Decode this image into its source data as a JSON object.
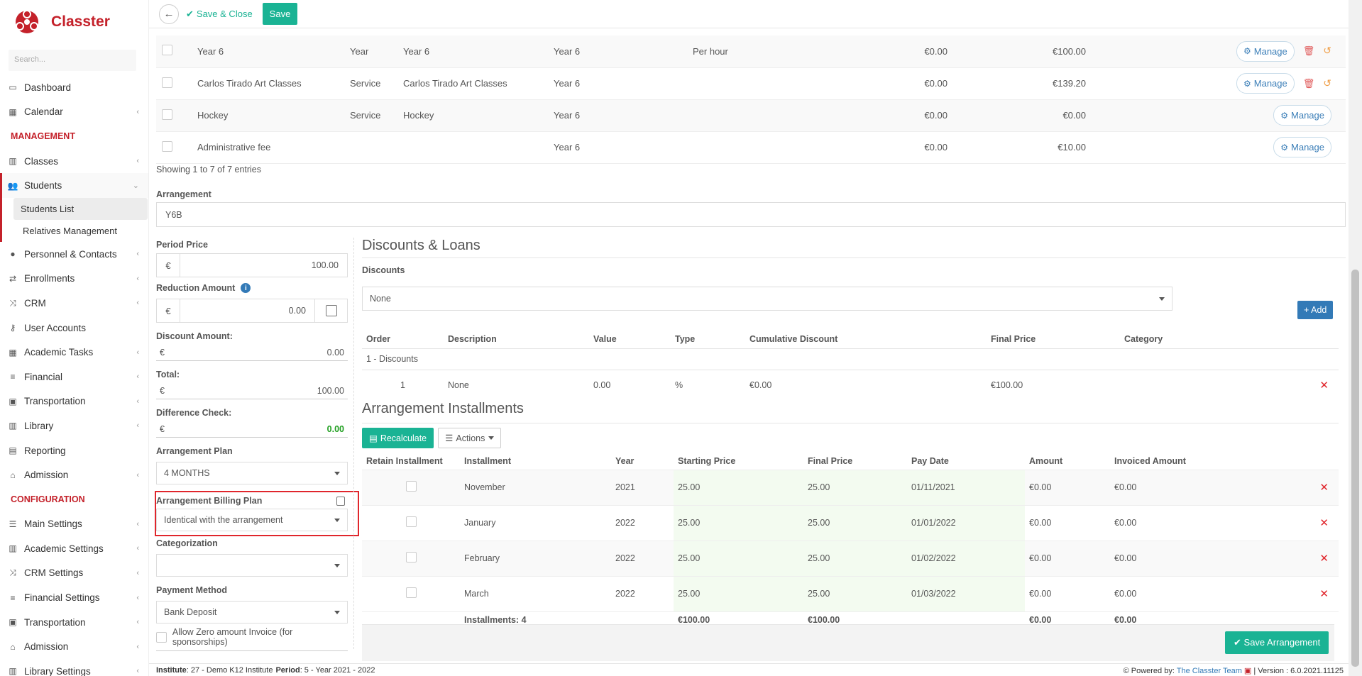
{
  "app": {
    "name": "Classter",
    "search_placeholder": "Search..."
  },
  "sidebar": {
    "items": [
      {
        "label": "Dashboard",
        "icon": "monitor-icon"
      },
      {
        "label": "Calendar",
        "icon": "calendar-icon"
      },
      {
        "section": "MANAGEMENT"
      },
      {
        "label": "Classes",
        "icon": "classes-icon"
      },
      {
        "label": "Students",
        "icon": "users-icon"
      },
      {
        "label": "Personnel & Contacts",
        "icon": "person-icon"
      },
      {
        "label": "Enrollments",
        "icon": "transfer-icon"
      },
      {
        "label": "CRM",
        "icon": "crm-icon"
      },
      {
        "label": "User Accounts",
        "icon": "key-icon"
      },
      {
        "label": "Academic Tasks",
        "icon": "grid-icon"
      },
      {
        "label": "Financial",
        "icon": "coins-icon"
      },
      {
        "label": "Transportation",
        "icon": "bus-icon"
      },
      {
        "label": "Library",
        "icon": "library-icon"
      },
      {
        "label": "Reporting",
        "icon": "print-icon"
      },
      {
        "label": "Admission",
        "icon": "bank-icon"
      },
      {
        "section": "CONFIGURATION"
      },
      {
        "label": "Main Settings",
        "icon": "sliders-icon"
      },
      {
        "label": "Academic Settings",
        "icon": "classes-icon"
      },
      {
        "label": "CRM Settings",
        "icon": "crm-icon"
      },
      {
        "label": "Financial Settings",
        "icon": "coins-icon"
      },
      {
        "label": "Transportation",
        "icon": "bus-icon"
      },
      {
        "label": "Admission",
        "icon": "bank-icon"
      },
      {
        "label": "Library Settings",
        "icon": "library-icon"
      }
    ],
    "sub_students": [
      "Students List",
      "Relatives Management"
    ],
    "section_management": "MANAGEMENT",
    "section_configuration": "CONFIGURATION"
  },
  "toolbar": {
    "save_close": "Save & Close",
    "save": "Save"
  },
  "services": {
    "rows": [
      {
        "name": "Year 6",
        "type": "Year",
        "desc": "Year 6",
        "level": "Year 6",
        "unit": "Per hour",
        "discount": "€0.00",
        "price": "€100.00",
        "manage": "Manage",
        "actions": true
      },
      {
        "name": "Carlos Tirado Art Classes",
        "type": "Service",
        "desc": "Carlos Tirado Art Classes",
        "level": "Year 6",
        "unit": "",
        "discount": "€0.00",
        "price": "€139.20",
        "manage": "Manage",
        "actions": true
      },
      {
        "name": "Hockey",
        "type": "Service",
        "desc": "Hockey",
        "level": "Year 6",
        "unit": "",
        "discount": "€0.00",
        "price": "€0.00",
        "manage": "Manage",
        "actions": false
      },
      {
        "name": "Administrative fee",
        "type": "",
        "desc": "",
        "level": "Year 6",
        "unit": "",
        "discount": "€0.00",
        "price": "€10.00",
        "manage": "Manage",
        "actions": false
      }
    ],
    "showing": "Showing 1 to 7 of 7 entries"
  },
  "arrangement": {
    "label": "Arrangement",
    "value": "Y6B"
  },
  "form": {
    "period_price_label": "Period Price",
    "period_price": "100.00",
    "reduction_label": "Reduction Amount",
    "reduction": "0.00",
    "discount_amount_label": "Discount Amount:",
    "discount_amount": "0.00",
    "total_label": "Total:",
    "total": "100.00",
    "diff_label": "Difference Check:",
    "diff": "0.00",
    "plan_label": "Arrangement Plan",
    "plan": "4 MONTHS",
    "billing_label": "Arrangement Billing Plan",
    "billing": "Identical with the arrangement",
    "categorization_label": "Categorization",
    "categorization": "",
    "payment_label": "Payment Method",
    "payment": "Bank Deposit",
    "zero_label": "Allow Zero amount Invoice (for sponsorships)",
    "currency": "€"
  },
  "discounts": {
    "title": "Discounts & Loans",
    "label": "Discounts",
    "selected": "None",
    "add": "Add",
    "headers": [
      "Order",
      "Description",
      "Value",
      "Type",
      "Cumulative Discount",
      "Final Price",
      "Category"
    ],
    "group": "1 - Discounts",
    "rows": [
      {
        "order": "1",
        "desc": "None",
        "value": "0.00",
        "type": "%",
        "cumulative": "€0.00",
        "final": "€100.00",
        "category": ""
      }
    ]
  },
  "installments": {
    "title": "Arrangement Installments",
    "recalculate": "Recalculate",
    "actions": "Actions",
    "headers": [
      "Retain Installment",
      "Installment",
      "Year",
      "Starting Price",
      "Final Price",
      "Pay Date",
      "Amount",
      "Invoiced Amount"
    ],
    "rows": [
      {
        "name": "November",
        "year": "2021",
        "start": "25.00",
        "final": "25.00",
        "date": "01/11/2021",
        "amount": "€0.00",
        "invoiced": "€0.00"
      },
      {
        "name": "January",
        "year": "2022",
        "start": "25.00",
        "final": "25.00",
        "date": "01/01/2022",
        "amount": "€0.00",
        "invoiced": "€0.00"
      },
      {
        "name": "February",
        "year": "2022",
        "start": "25.00",
        "final": "25.00",
        "date": "01/02/2022",
        "amount": "€0.00",
        "invoiced": "€0.00"
      },
      {
        "name": "March",
        "year": "2022",
        "start": "25.00",
        "final": "25.00",
        "date": "01/03/2022",
        "amount": "€0.00",
        "invoiced": "€0.00"
      }
    ],
    "totals": {
      "label": "Installments: 4",
      "start": "€100.00",
      "final": "€100.00",
      "amount": "€0.00",
      "invoiced": "€0.00"
    },
    "save": "Save Arrangement"
  },
  "footer": {
    "institute_label": "Institute",
    "institute": ": 27 - Demo K12 Institute",
    "period_label": "Period",
    "period": ": 5 - Year 2021 - 2022",
    "powered": "Powered by:",
    "team": "The Classter Team",
    "version": "| Version : 6.0.2021.11125"
  },
  "colors": {
    "brand": "#c4212a",
    "accent": "#1ab394",
    "link": "#337ab7"
  }
}
